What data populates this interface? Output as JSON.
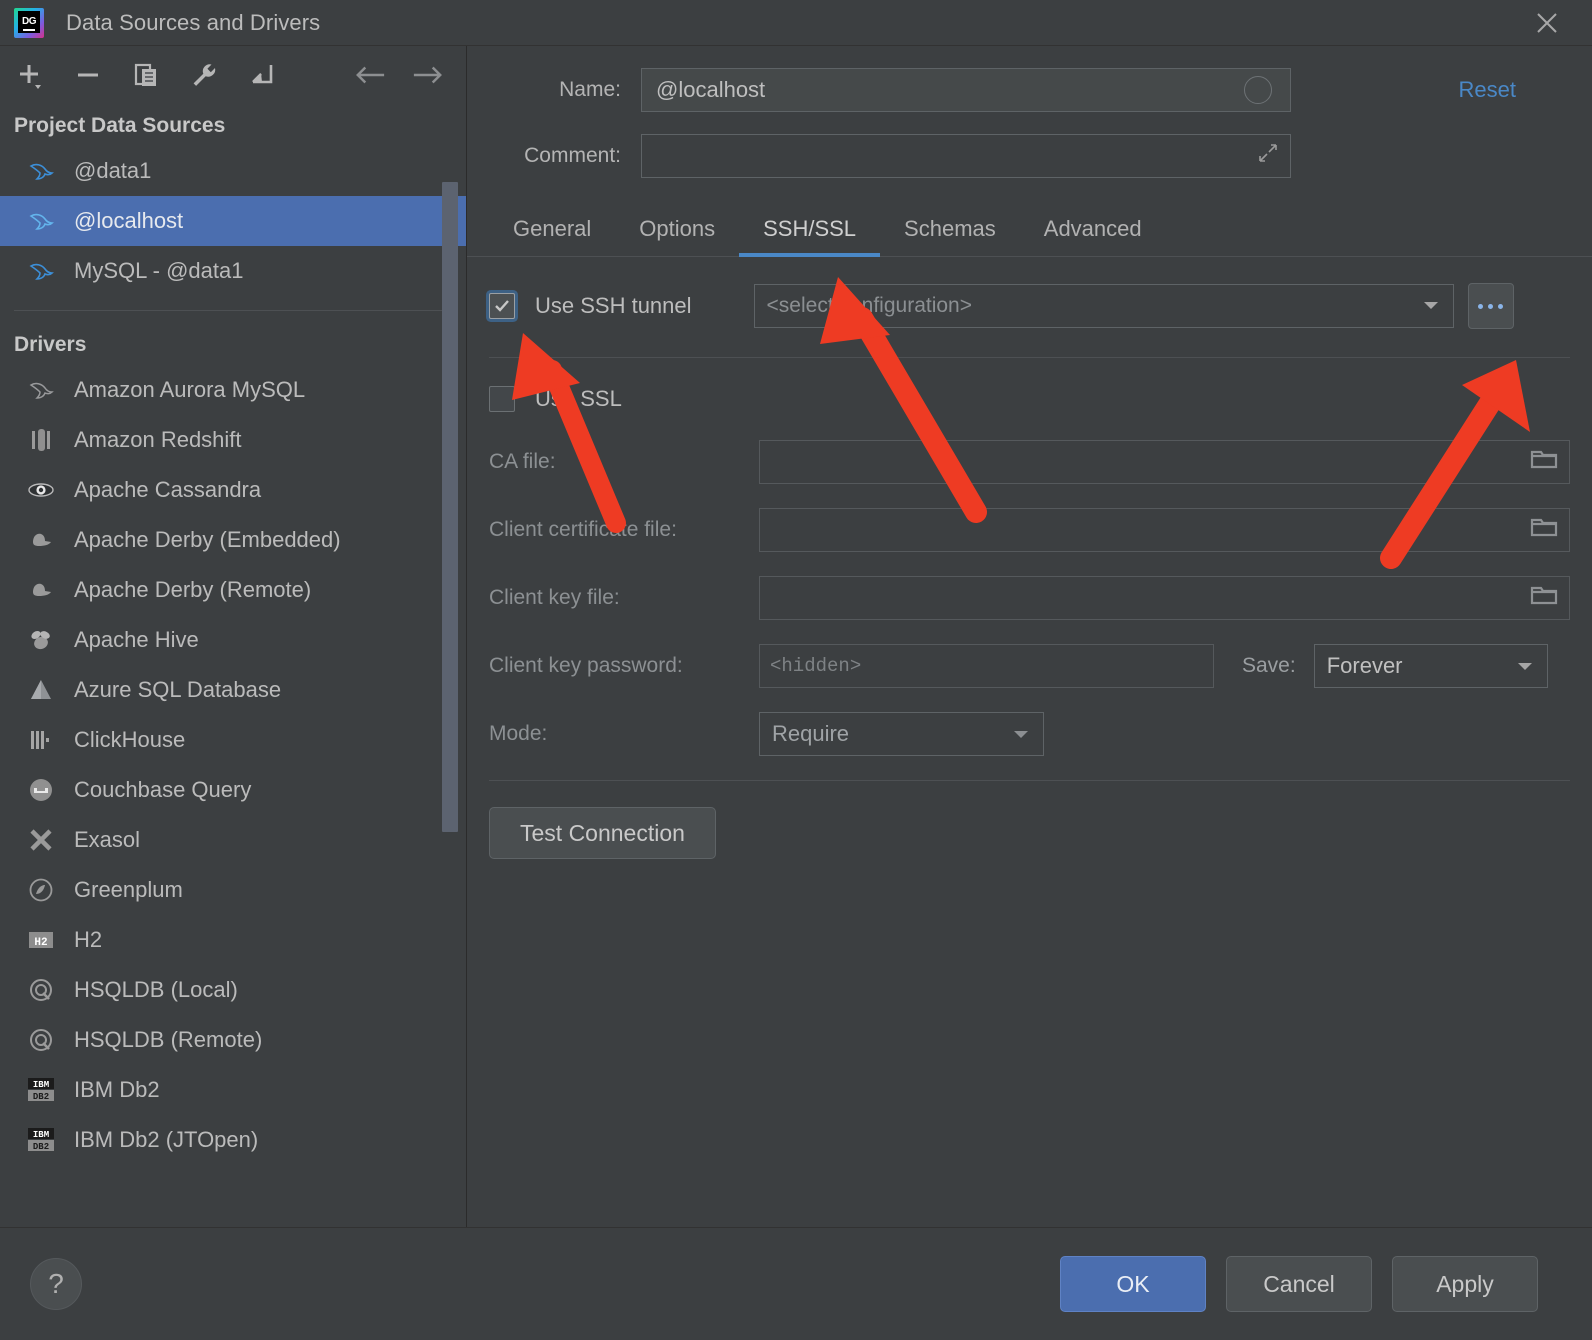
{
  "window": {
    "title": "Data Sources and Drivers",
    "logo_text": "DG",
    "close_icon": "close-icon"
  },
  "left_pane": {
    "toolbar": [
      {
        "name": "add-data-source-button",
        "icon": "plus-icon"
      },
      {
        "name": "remove-data-source-button",
        "icon": "minus-icon"
      },
      {
        "name": "duplicate-data-source-button",
        "icon": "copy-icon"
      },
      {
        "name": "properties-button",
        "icon": "wrench-icon"
      },
      {
        "name": "import-button",
        "icon": "import-arrow-icon"
      }
    ],
    "nav": [
      {
        "name": "back-button",
        "icon": "arrow-left-icon"
      },
      {
        "name": "forward-button",
        "icon": "arrow-right-icon"
      }
    ],
    "project_sources_title": "Project Data Sources",
    "data_sources": [
      {
        "label": "@data1",
        "icon": "mysql-dolphin-icon",
        "selected": false
      },
      {
        "label": "@localhost",
        "icon": "mysql-dolphin-icon",
        "selected": true
      },
      {
        "label": "MySQL - @data1",
        "icon": "mysql-dolphin-icon",
        "selected": false
      }
    ],
    "drivers_title": "Drivers",
    "drivers": [
      {
        "label": "Amazon Aurora MySQL",
        "icon": "mysql-dolphin-icon"
      },
      {
        "label": "Amazon Redshift",
        "icon": "redshift-icon"
      },
      {
        "label": "Apache Cassandra",
        "icon": "cassandra-eye-icon"
      },
      {
        "label": "Apache Derby (Embedded)",
        "icon": "derby-hat-icon"
      },
      {
        "label": "Apache Derby (Remote)",
        "icon": "derby-hat-icon"
      },
      {
        "label": "Apache Hive",
        "icon": "hive-bee-icon"
      },
      {
        "label": "Azure SQL Database",
        "icon": "azure-icon"
      },
      {
        "label": "ClickHouse",
        "icon": "clickhouse-icon"
      },
      {
        "label": "Couchbase Query",
        "icon": "couchbase-icon"
      },
      {
        "label": "Exasol",
        "icon": "exasol-x-icon"
      },
      {
        "label": "Greenplum",
        "icon": "greenplum-icon"
      },
      {
        "label": "H2",
        "icon": "h2-icon"
      },
      {
        "label": "HSQLDB (Local)",
        "icon": "hsqldb-icon"
      },
      {
        "label": "HSQLDB (Remote)",
        "icon": "hsqldb-icon"
      },
      {
        "label": "IBM Db2",
        "icon": "ibm-db2-icon"
      },
      {
        "label": "IBM Db2 (JTOpen)",
        "icon": "ibm-db2-icon"
      }
    ]
  },
  "right_pane": {
    "name_label": "Name:",
    "name_value": "@localhost",
    "comment_label": "Comment:",
    "comment_value": "",
    "comment_placeholder": "",
    "reset_label": "Reset",
    "tabs": [
      {
        "label": "General",
        "active": false
      },
      {
        "label": "Options",
        "active": false
      },
      {
        "label": "SSH/SSL",
        "active": true
      },
      {
        "label": "Schemas",
        "active": false
      },
      {
        "label": "Advanced",
        "active": false
      }
    ],
    "ssh": {
      "use_ssh_tunnel_label": "Use SSH tunnel",
      "use_ssh_tunnel_checked": true,
      "config_placeholder": "<select configuration>",
      "config_value": "",
      "more_button_label": "..."
    },
    "ssl": {
      "use_ssl_label": "Use SSL",
      "use_ssl_checked": false,
      "ca_file_label": "CA file:",
      "ca_file_value": "",
      "client_certificate_label": "Client certificate file:",
      "client_certificate_value": "",
      "client_key_label": "Client key file:",
      "client_key_value": "",
      "client_key_password_label": "Client key password:",
      "client_key_password_placeholder": "<hidden>",
      "save_label": "Save:",
      "save_value": "Forever",
      "mode_label": "Mode:",
      "mode_value": "Require"
    },
    "test_connection_label": "Test Connection"
  },
  "footer": {
    "help_label": "?",
    "ok_label": "OK",
    "cancel_label": "Cancel",
    "apply_label": "Apply"
  },
  "annotations": {
    "color": "#ee3b23",
    "arrows": [
      {
        "name": "arrow-to-use-ssh-tunnel-checkbox",
        "target": "use-ssh-tunnel-checkbox"
      },
      {
        "name": "arrow-to-ssh-ssl-tab",
        "target": "tab-ssh-ssl"
      },
      {
        "name": "arrow-to-ssh-config-more-button",
        "target": "ssh-config-more-button"
      }
    ]
  },
  "colors": {
    "accent_blue": "#4b6eaf",
    "link_blue": "#4a88c7",
    "panel_bg": "#3c3f41",
    "annotation_red": "#ee3b23"
  }
}
